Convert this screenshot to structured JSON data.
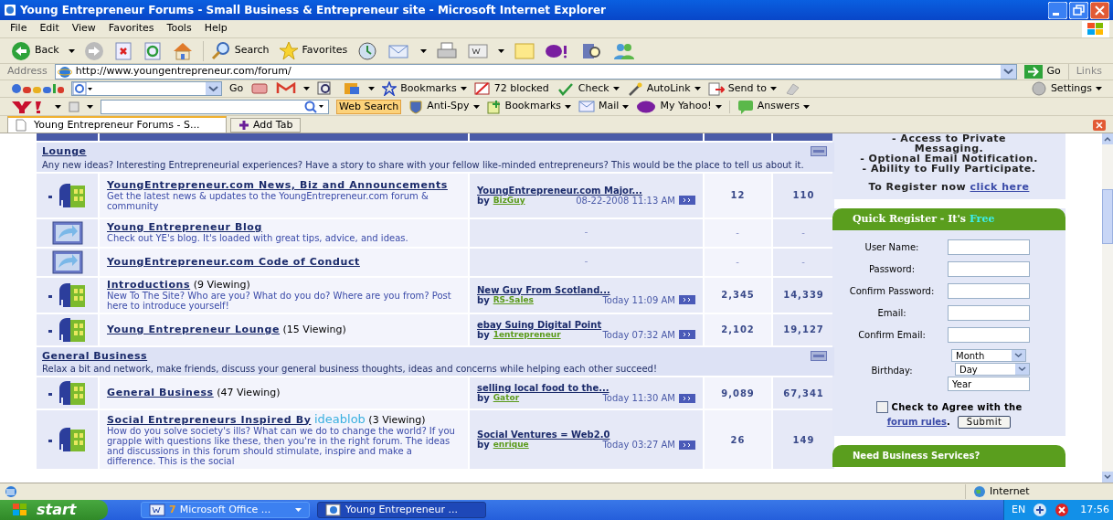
{
  "window": {
    "title": "Young Entrepreneur Forums - Small Business & Entrepreneur site - Microsoft Internet Explorer"
  },
  "menu": [
    "File",
    "Edit",
    "View",
    "Favorites",
    "Tools",
    "Help"
  ],
  "toolbar": {
    "back": "Back",
    "search": "Search",
    "favorites": "Favorites"
  },
  "address_bar": {
    "label": "Address",
    "url": "http://www.youngentrepreneur.com/forum/",
    "go": "Go",
    "links": "Links"
  },
  "google_bar": {
    "go": "Go",
    "bookmarks": "Bookmarks",
    "blocked": "72 blocked",
    "check": "Check",
    "autolink": "AutoLink",
    "send_to": "Send to",
    "settings": "Settings"
  },
  "yahoo_bar": {
    "search_button": "Web Search",
    "anti_spy": "Anti-Spy",
    "bookmarks": "Bookmarks",
    "mail": "Mail",
    "my_yahoo": "My Yahoo!",
    "answers": "Answers"
  },
  "tabs": [
    {
      "label": "Young Entrepreneur Forums - S...",
      "selected": true
    }
  ],
  "add_tab": "Add Tab",
  "categories": [
    {
      "title": "Lounge",
      "description": "Any new ideas? Interesting Entrepreneurial experiences? Have a story to share with your fellow like-minded entrepreneurs? This would be the place to tell us about it.",
      "forums": [
        {
          "kind": "forum",
          "title": "YoungEntrepreneur.com News, Biz and Announcements",
          "description": "Get the latest news & updates to the YoungEntrepreneur.com forum & community",
          "last_post": {
            "title": "YoungEntrepreneur.com Major...",
            "by": "by",
            "author": "BizGuy",
            "time": "08-22-2008 11:13 AM"
          },
          "threads": "12",
          "posts": "110"
        },
        {
          "kind": "link",
          "title": "Young Entrepreneur Blog",
          "description": "Check out YE's blog. It's loaded with great tips, advice, and ideas.",
          "last_post": {
            "dash": "-"
          },
          "threads": "-",
          "posts": "-"
        },
        {
          "kind": "link",
          "title": "YoungEntrepreneur.com Code of Conduct",
          "last_post": {
            "dash": "-"
          },
          "threads": "-",
          "posts": "-"
        },
        {
          "kind": "forum",
          "title": "Introductions",
          "viewing": "(9 Viewing)",
          "description": "New To The Site? Who are you? What do you do? Where are you from? Post here to introduce yourself!",
          "last_post": {
            "title": "New Guy From Scotland...",
            "by": "by",
            "author": "RS-Sales",
            "time": "Today 11:09 AM"
          },
          "threads": "2,345",
          "posts": "14,339"
        },
        {
          "kind": "forum",
          "title": "Young Entrepreneur Lounge",
          "viewing": "(15 Viewing)",
          "last_post": {
            "title": "ebay Suing Digital Point",
            "by": "by",
            "author": "1entrepreneur",
            "time": "Today 07:32 AM"
          },
          "threads": "2,102",
          "posts": "19,127"
        }
      ]
    },
    {
      "title": "General Business",
      "description": "Relax a bit and network, make friends, discuss your general business thoughts, ideas and concerns while helping each other succeed!",
      "forums": [
        {
          "kind": "forum",
          "title": "General Business",
          "viewing": "(47 Viewing)",
          "last_post": {
            "title": "selling local food to the...",
            "by": "by",
            "author": "Gator",
            "time": "Today 11:30 AM"
          },
          "threads": "9,089",
          "posts": "67,341"
        },
        {
          "kind": "forum",
          "title": "Social Entrepreneurs Inspired By",
          "sponsor": "ideablob",
          "viewing": "(3 Viewing)",
          "description": "How do you solve society's ills? What can we do to change the world? If you grapple with questions like these, then you're in the right forum. The ideas and discussions in this forum should stimulate, inspire and make a difference. This is the social",
          "last_post": {
            "title": "Social Ventures = Web2.0",
            "by": "by",
            "author": "enrique",
            "time": "Today 03:27 AM"
          },
          "threads": "26",
          "posts": "149"
        }
      ]
    }
  ],
  "register_info": {
    "lines": [
      "- Access to Private",
      "Messaging.",
      "- Optional Email Notification.",
      "- Ability to Fully Participate."
    ],
    "prompt": "To Register now",
    "link": "click here"
  },
  "quick_register": {
    "title": "Quick Register - It's",
    "title_highlight": "Free",
    "fields": [
      {
        "label": "User Name:"
      },
      {
        "label": "Password:"
      },
      {
        "label": "Confirm Password:"
      },
      {
        "label": "Email:"
      },
      {
        "label": "Confirm Email:"
      }
    ],
    "birthday": {
      "label": "Birthday:",
      "month": "Month",
      "day": "Day",
      "year": "Year"
    },
    "agree": {
      "checked": false,
      "text": "Check to Agree with the",
      "link": "forum rules",
      "tail": "."
    },
    "submit": "Submit"
  },
  "services": {
    "title": "Need Business Services?"
  },
  "status_bar": {
    "zone": "Internet"
  },
  "taskbar": {
    "start": "start",
    "tasks": [
      {
        "count": "7",
        "label": "Microsoft Office ...",
        "selected": false
      },
      {
        "label": "Young Entrepreneur ...",
        "selected": true
      }
    ],
    "language": "EN",
    "clock": "17:56"
  }
}
